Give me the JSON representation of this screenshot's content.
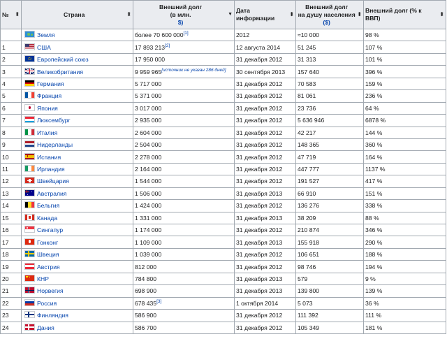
{
  "headers": {
    "num": "№",
    "country": "Страна",
    "debt_l1": "Внешний долг",
    "debt_l2": "(в млн.",
    "debt_l3": "$)",
    "date": "Дата информации",
    "per_l1": "Внешний долг",
    "per_l2": "на душу населения",
    "per_l3": "($)",
    "gdp": "Внешний долг (% к ВВП)"
  },
  "rows": [
    {
      "num": "",
      "country": "Земля",
      "flag": "earth",
      "debt": "более 70 600 000",
      "ref": "[1]",
      "date": "2012",
      "per": "≈10 000",
      "gdp": "98 %"
    },
    {
      "num": "1",
      "country": "США",
      "flag": "us",
      "debt": "17 893 213",
      "ref": "[2]",
      "date": "12 августа 2014",
      "per": "51 245",
      "gdp": "107 %"
    },
    {
      "num": "2",
      "country": "Европейский союз",
      "flag": "eu",
      "debt": "17 950 000",
      "date": "31 декабря 2012",
      "per": "31 313",
      "gdp": "101 %"
    },
    {
      "num": "3",
      "country": "Великобритания",
      "flag": "gb",
      "debt": "9 959 965",
      "note": "[источник не указан 286 дней]",
      "date": "30 сентября 2013",
      "per": "157 640",
      "gdp": "396 %"
    },
    {
      "num": "4",
      "country": "Германия",
      "flag": "de",
      "debt": "5 717 000",
      "date": "31 декабря 2012",
      "per": "70 583",
      "gdp": "159 %"
    },
    {
      "num": "5",
      "country": "Франция",
      "flag": "fr",
      "debt": "5 371 000",
      "date": "31 декабря 2012",
      "per": "81 061",
      "gdp": "236 %"
    },
    {
      "num": "6",
      "country": "Япония",
      "flag": "jp",
      "debt": "3 017 000",
      "date": "31 декабря 2012",
      "per": "23 736",
      "gdp": "64 %"
    },
    {
      "num": "7",
      "country": "Люксембург",
      "flag": "lu",
      "debt": "2 935 000",
      "date": "31 декабря 2012",
      "per": "5 636 946",
      "gdp": "6878 %"
    },
    {
      "num": "8",
      "country": "Италия",
      "flag": "it",
      "debt": "2 604 000",
      "date": "31 декабря 2012",
      "per": "42 217",
      "gdp": "144 %"
    },
    {
      "num": "9",
      "country": "Нидерланды",
      "flag": "nl",
      "debt": "2 504 000",
      "date": "31 декабря 2012",
      "per": "148 365",
      "gdp": "360 %"
    },
    {
      "num": "10",
      "country": "Испания",
      "flag": "es",
      "debt": "2 278 000",
      "date": "31 декабря 2012",
      "per": "47 719",
      "gdp": "164 %"
    },
    {
      "num": "11",
      "country": "Ирландия",
      "flag": "ie",
      "debt": "2 164 000",
      "date": "31 декабря 2012",
      "per": "447 777",
      "gdp": "1137 %"
    },
    {
      "num": "12",
      "country": "Швейцария",
      "flag": "ch",
      "debt": "1 544 000",
      "date": "31 декабря 2012",
      "per": "191 527",
      "gdp": "417 %"
    },
    {
      "num": "13",
      "country": "Австралия",
      "flag": "au",
      "debt": "1 506 000",
      "date": "31 декабря 2013",
      "per": "66 910",
      "gdp": "151 %"
    },
    {
      "num": "14",
      "country": "Бельгия",
      "flag": "be",
      "debt": "1 424 000",
      "date": "31 декабря 2012",
      "per": "136 276",
      "gdp": "338 %"
    },
    {
      "num": "15",
      "country": "Канада",
      "flag": "ca",
      "debt": "1 331 000",
      "date": "31 декабря 2013",
      "per": "38 209",
      "gdp": "88 %"
    },
    {
      "num": "16",
      "country": "Сингапур",
      "flag": "sg",
      "debt": "1 174 000",
      "date": "31 декабря 2012",
      "per": "210 874",
      "gdp": "346 %"
    },
    {
      "num": "17",
      "country": "Гонконг",
      "flag": "hk",
      "debt": "1 109 000",
      "date": "31 декабря 2013",
      "per": "155 918",
      "gdp": "290 %"
    },
    {
      "num": "18",
      "country": "Швеция",
      "flag": "se",
      "debt": "1 039 000",
      "date": "31 декабря 2012",
      "per": "106 651",
      "gdp": "188 %"
    },
    {
      "num": "19",
      "country": "Австрия",
      "flag": "at",
      "debt": "812 000",
      "date": "31 декабря 2012",
      "per": "98 746",
      "gdp": "194 %"
    },
    {
      "num": "20",
      "country": "КНР",
      "flag": "cn",
      "debt": "784 800",
      "date": "31 декабря 2013",
      "per": "579",
      "gdp": "9 %"
    },
    {
      "num": "21",
      "country": "Норвегия",
      "flag": "no",
      "debt": "698 900",
      "date": "31 декабря 2013",
      "per": "139 800",
      "gdp": "139 %"
    },
    {
      "num": "22",
      "country": "Россия",
      "flag": "ru",
      "debt": "678 435",
      "ref": "[3]",
      "date": "1 октября 2014",
      "per": "5 073",
      "gdp": "36 %"
    },
    {
      "num": "23",
      "country": "Финляндия",
      "flag": "fi",
      "debt": "586 900",
      "date": "31 декабря 2012",
      "per": "111 392",
      "gdp": "111 %"
    },
    {
      "num": "24",
      "country": "Дания",
      "flag": "dk",
      "debt": "586 700",
      "date": "31 декабря 2012",
      "per": "105 349",
      "gdp": "181 %"
    }
  ]
}
